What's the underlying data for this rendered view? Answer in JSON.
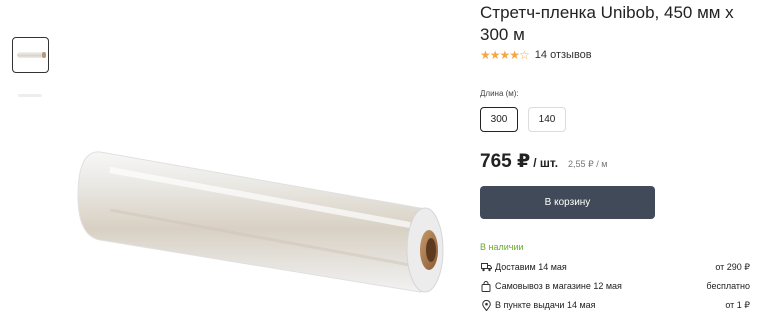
{
  "product": {
    "title": "Стретч-пленка Unibob, 450 мм х 300 м",
    "rating_stars": "★★★★☆",
    "reviews": "14 отзывов"
  },
  "options": {
    "label": "Длина (м):",
    "values": [
      "300",
      "140"
    ],
    "selected": "300"
  },
  "price": {
    "main": "765 ₽",
    "per": "/ шт.",
    "unit": "2,55 ₽ / м"
  },
  "cart_button": "В корзину",
  "stock": "В наличии",
  "delivery": [
    {
      "icon": "truck-icon",
      "text": "Доставим 14 мая",
      "price": "от 290 ₽"
    },
    {
      "icon": "bag-icon",
      "text": "Самовывоз в магазине 12 мая",
      "price": "бесплатно"
    },
    {
      "icon": "location-pin-icon",
      "text": "В пункте выдачи 14 мая",
      "price": "от 1 ₽"
    }
  ]
}
